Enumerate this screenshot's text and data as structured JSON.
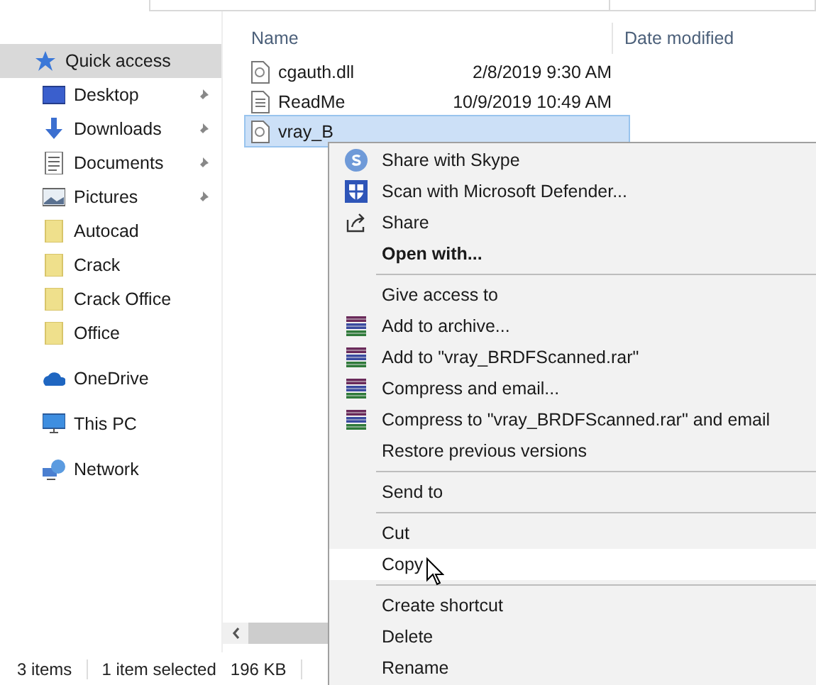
{
  "sidebar": {
    "items": [
      {
        "label": "Quick access",
        "kind": "quick",
        "selected": true,
        "pinned": false
      },
      {
        "label": "Desktop",
        "kind": "desktop",
        "selected": false,
        "pinned": true
      },
      {
        "label": "Downloads",
        "kind": "downloads",
        "selected": false,
        "pinned": true
      },
      {
        "label": "Documents",
        "kind": "documents",
        "selected": false,
        "pinned": true
      },
      {
        "label": "Pictures",
        "kind": "pictures",
        "selected": false,
        "pinned": true
      },
      {
        "label": "Autocad",
        "kind": "folder",
        "selected": false,
        "pinned": false
      },
      {
        "label": "Crack",
        "kind": "folder",
        "selected": false,
        "pinned": false
      },
      {
        "label": "Crack Office",
        "kind": "folder",
        "selected": false,
        "pinned": false
      },
      {
        "label": "Office",
        "kind": "folder",
        "selected": false,
        "pinned": false
      },
      {
        "label": "OneDrive",
        "kind": "onedrive",
        "selected": false,
        "pinned": false
      },
      {
        "label": "This PC",
        "kind": "pc",
        "selected": false,
        "pinned": false
      },
      {
        "label": "Network",
        "kind": "network",
        "selected": false,
        "pinned": false
      }
    ]
  },
  "file_list": {
    "columns": [
      "Name",
      "Date modified"
    ],
    "rows": [
      {
        "name": "cgauth.dll",
        "kind": "dll",
        "date": "2/8/2019 9:30 AM",
        "selected": false
      },
      {
        "name": "ReadMe",
        "kind": "text",
        "date": "10/9/2019 10:49 AM",
        "selected": false
      },
      {
        "name": "vray_B",
        "kind": "dll",
        "selected": true
      }
    ]
  },
  "context_menu": {
    "items": [
      {
        "kind": "skype",
        "label": "Share with Skype",
        "selected": false
      },
      {
        "kind": "defender",
        "label": "Scan with Microsoft Defender...",
        "selected": false
      },
      {
        "kind": "share",
        "label": "Share",
        "selected": false
      },
      {
        "kind": "plain",
        "label": "Open with...",
        "bold": true,
        "selected": false
      },
      {
        "kind": "separator"
      },
      {
        "kind": "plain",
        "label": "Give access to",
        "selected": false
      },
      {
        "kind": "winrar",
        "label": "Add to archive...",
        "selected": false
      },
      {
        "kind": "winrar",
        "label": "Add to \"vray_BRDFScanned.rar\"",
        "selected": false
      },
      {
        "kind": "winrar",
        "label": "Compress and email...",
        "selected": false
      },
      {
        "kind": "winrar",
        "label": "Compress to \"vray_BRDFScanned.rar\" and email",
        "selected": false
      },
      {
        "kind": "plain",
        "label": "Restore previous versions",
        "selected": false
      },
      {
        "kind": "separator"
      },
      {
        "kind": "plain",
        "label": "Send to",
        "selected": false
      },
      {
        "kind": "separator"
      },
      {
        "kind": "plain",
        "label": "Cut",
        "selected": false
      },
      {
        "kind": "plain",
        "label": "Copy",
        "selected": true
      },
      {
        "kind": "separator"
      },
      {
        "kind": "plain",
        "label": "Create shortcut",
        "selected": false
      },
      {
        "kind": "plain",
        "label": "Delete",
        "selected": false
      },
      {
        "kind": "plain",
        "label": "Rename",
        "selected": false
      }
    ]
  },
  "status_bar": {
    "item_count": "3 items",
    "selection": "1 item selected",
    "size": "196 KB"
  }
}
